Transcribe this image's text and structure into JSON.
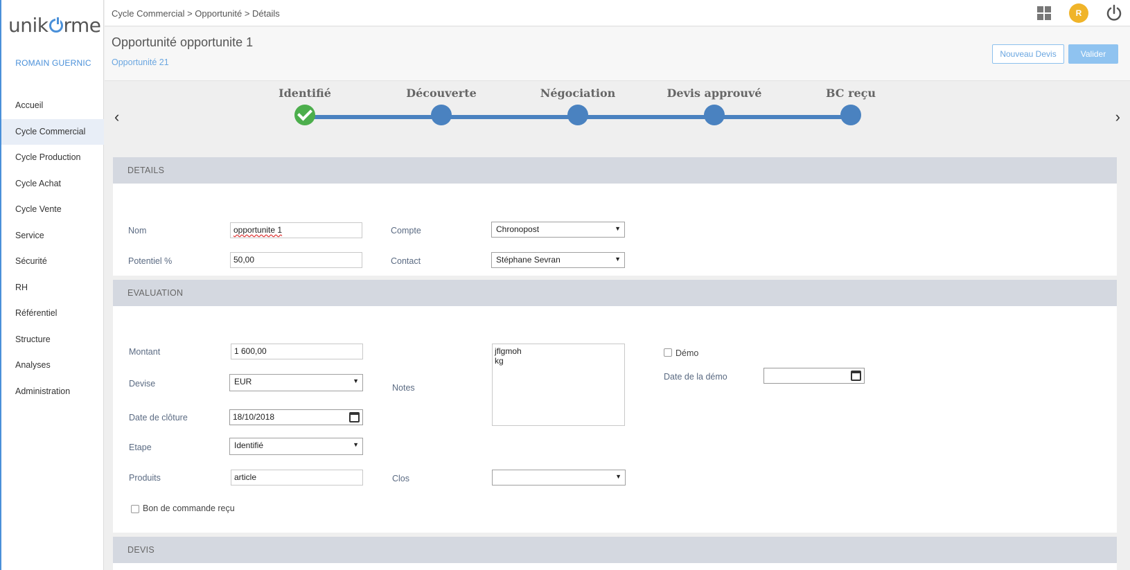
{
  "sidebar": {
    "logo_left": "unik",
    "logo_right": "rme",
    "user_name": "ROMAIN GUERNIC",
    "items": [
      {
        "label": "Accueil"
      },
      {
        "label": "Cycle Commercial"
      },
      {
        "label": "Cycle Production"
      },
      {
        "label": "Cycle Achat"
      },
      {
        "label": "Cycle Vente"
      },
      {
        "label": "Service"
      },
      {
        "label": "Sécurité"
      },
      {
        "label": "RH"
      },
      {
        "label": "Référentiel"
      },
      {
        "label": "Structure"
      },
      {
        "label": "Analyses"
      },
      {
        "label": "Administration"
      }
    ]
  },
  "header": {
    "breadcrumb": "Cycle Commercial > Opportunité > Détails",
    "avatar_initial": "R"
  },
  "titlebar": {
    "title": "Opportunité opportunite 1",
    "subtitle": "Opportunité 21",
    "new_quote_label": "Nouveau Devis",
    "validate_label": "Valider"
  },
  "stepper": {
    "prev": "‹",
    "next": "›",
    "steps": [
      {
        "label": "Identifié",
        "done": true
      },
      {
        "label": "Découverte"
      },
      {
        "label": "Négociation"
      },
      {
        "label": "Devis approuvé"
      },
      {
        "label": "BC reçu"
      }
    ]
  },
  "details": {
    "heading": "DETAILS",
    "nom_label": "Nom",
    "nom_value": "opportunite 1",
    "compte_label": "Compte",
    "compte_value": "Chronopost",
    "potentiel_label": "Potentiel %",
    "potentiel_value": "50,00",
    "contact_label": "Contact",
    "contact_value": "Stéphane Sevran"
  },
  "evaluation": {
    "heading": "EVALUATION",
    "montant_label": "Montant",
    "montant_value": "1 600,00",
    "devise_label": "Devise",
    "devise_value": "EUR",
    "cloture_label": "Date de clôture",
    "cloture_value": "18/10/2018",
    "etape_label": "Etape",
    "etape_value": "Identifié",
    "produits_label": "Produits",
    "produits_value": "article",
    "notes_label": "Notes",
    "notes_value": "jflgmoh\nkg",
    "clos_label": "Clos",
    "clos_value": "",
    "demo_label": "Démo",
    "demo_date_label": "Date de la démo",
    "demo_date_value": "",
    "bc_label": "Bon de commande reçu"
  },
  "devis": {
    "heading": "DEVIS"
  },
  "colors": {
    "accent": "#4a90d9",
    "step_blue": "#4a82c0",
    "step_done": "#4cae4c",
    "avatar": "#f0b429",
    "panel_head": "#d4d8e0"
  }
}
